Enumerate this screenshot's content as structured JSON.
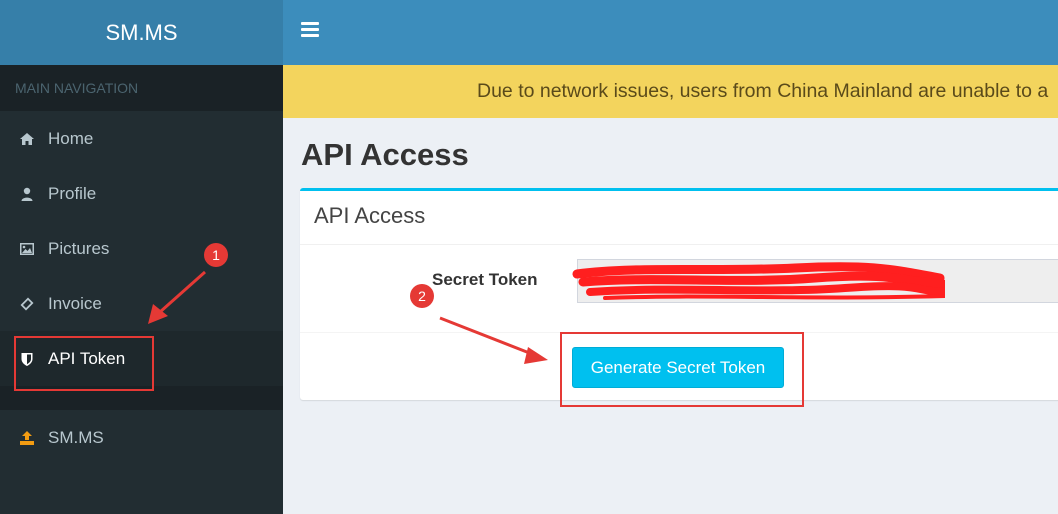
{
  "app": {
    "logo_text": "SM.MS"
  },
  "sidebar": {
    "header": "MAIN NAVIGATION",
    "items": [
      {
        "label": "Home",
        "icon": "home-icon"
      },
      {
        "label": "Profile",
        "icon": "user-icon"
      },
      {
        "label": "Pictures",
        "icon": "image-icon"
      },
      {
        "label": "Invoice",
        "icon": "ticket-icon"
      },
      {
        "label": "API Token",
        "icon": "shield-icon",
        "active": true
      },
      {
        "label": "SM.MS",
        "icon": "upload-icon"
      }
    ]
  },
  "topbar": {
    "menu_icon": "hamburger-icon"
  },
  "notice": {
    "text": "Due to network issues, users from China Mainland are unable to a"
  },
  "main": {
    "page_title": "API Access",
    "box_title": "API Access",
    "secret_token_label": "Secret Token",
    "generate_button_label": "Generate Secret Token"
  },
  "annotations": {
    "badge1": "1",
    "badge2": "2",
    "color": "#e53935"
  },
  "colors": {
    "sidebar": "#222d32",
    "logo": "#367fa9",
    "topbar": "#3c8dbc",
    "notice": "#f3d45d",
    "accent": "#00c0ef"
  }
}
